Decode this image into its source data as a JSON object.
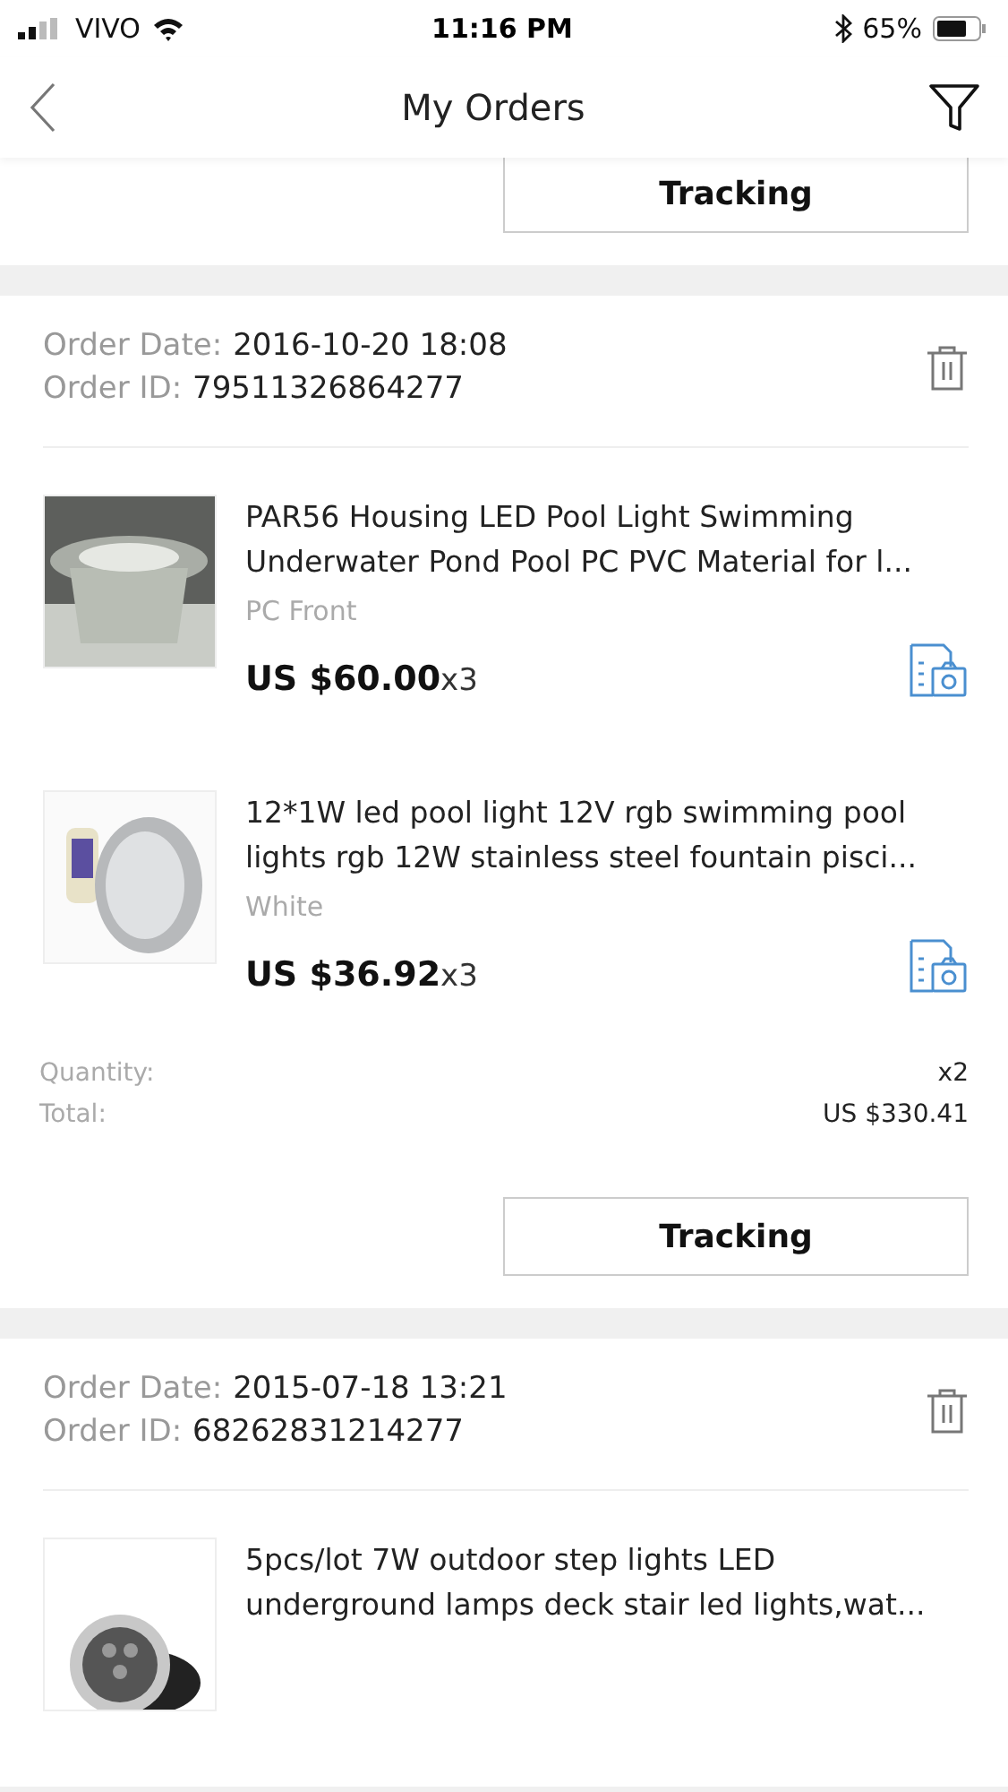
{
  "status_bar": {
    "carrier": "VIVO",
    "time": "11:16 PM",
    "battery": "65%"
  },
  "nav": {
    "title": "My Orders"
  },
  "previous_order": {
    "button": "Tracking"
  },
  "orders": [
    {
      "date_label": "Order Date:",
      "date": "2016-10-20 18:08",
      "id_label": "Order ID:",
      "id": "79511326864277",
      "products": [
        {
          "title": "PAR56 Housing LED Pool Light Swimming Underwater Pond Pool PC PVC Material for l...",
          "variant": "PC Front",
          "price": "US $60.00",
          "qty": "x3",
          "kind": "housing"
        },
        {
          "title": "12*1W led pool light 12V rgb swimming pool lights rgb 12W stainless steel  fountain pisci...",
          "variant": "White",
          "price": "US $36.92",
          "qty": "x3",
          "kind": "lamp"
        }
      ],
      "summary": [
        {
          "label": "Quantity:",
          "value": "x2"
        },
        {
          "label": "Total:",
          "value": "US $330.41"
        }
      ],
      "button": "Tracking"
    },
    {
      "date_label": "Order Date:",
      "date": "2015-07-18 13:21",
      "id_label": "Order ID:",
      "id": "68262831214277",
      "products": [
        {
          "title": "5pcs/lot 7W outdoor step lights LED underground lamps deck stair led lights,wat...",
          "kind": "spot"
        }
      ]
    }
  ]
}
